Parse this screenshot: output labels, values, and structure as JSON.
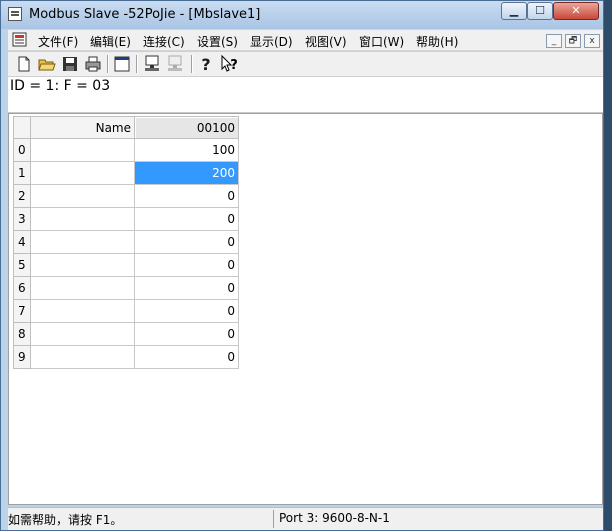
{
  "window": {
    "title": "Modbus Slave -52PoJie - [Mbslave1]",
    "caption_buttons": {
      "minimize": "▁",
      "maximize": "☐",
      "close": "✕"
    }
  },
  "menu": {
    "items": [
      "文件(F)",
      "编辑(E)",
      "连接(C)",
      "设置(S)",
      "显示(D)",
      "视图(V)",
      "窗口(W)",
      "帮助(H)"
    ],
    "mdi_buttons": [
      "_",
      "🗗",
      "x"
    ]
  },
  "toolbar": {
    "buttons": [
      "new-icon",
      "open-folder-icon",
      "save-disk-icon",
      "print-icon",
      "window-icon",
      "monitor-connect-icon",
      "monitor-disconnect-icon",
      "help-icon",
      "context-help-icon"
    ]
  },
  "info": {
    "text": "ID = 1: F = 03"
  },
  "grid": {
    "headers": {
      "name": "Name",
      "address": "00100"
    },
    "rows": [
      {
        "index": "0",
        "name": "",
        "value": "100"
      },
      {
        "index": "1",
        "name": "",
        "value": "200"
      },
      {
        "index": "2",
        "name": "",
        "value": "0"
      },
      {
        "index": "3",
        "name": "",
        "value": "0"
      },
      {
        "index": "4",
        "name": "",
        "value": "0"
      },
      {
        "index": "5",
        "name": "",
        "value": "0"
      },
      {
        "index": "6",
        "name": "",
        "value": "0"
      },
      {
        "index": "7",
        "name": "",
        "value": "0"
      },
      {
        "index": "8",
        "name": "",
        "value": "0"
      },
      {
        "index": "9",
        "name": "",
        "value": "0"
      }
    ],
    "selected_row": 1
  },
  "status": {
    "help": "如需帮助，请按 F1。",
    "port": "Port 3: 9600-8-N-1"
  },
  "colors": {
    "selection": "#3399ff",
    "title_bar": "#b9d1ea"
  }
}
